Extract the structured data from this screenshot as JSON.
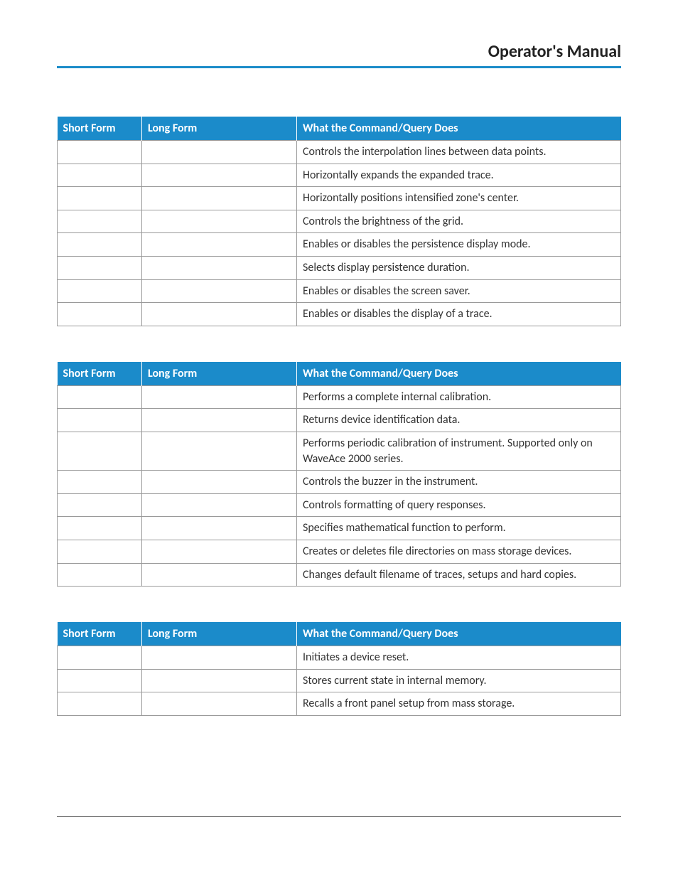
{
  "header": {
    "title": "Operator's Manual"
  },
  "tables": [
    {
      "title": "",
      "headers": [
        "Short Form",
        "Long Form",
        "What the Command/Query Does"
      ],
      "rows": [
        [
          "",
          "",
          "Controls the interpolation lines between data points."
        ],
        [
          "",
          "",
          "Horizontally expands the expanded trace."
        ],
        [
          "",
          "",
          "Horizontally positions intensified zone's center."
        ],
        [
          "",
          "",
          "Controls the brightness of the grid."
        ],
        [
          "",
          "",
          "Enables or disables the persistence display mode."
        ],
        [
          "",
          "",
          "Selects display persistence duration."
        ],
        [
          "",
          "",
          "Enables or disables the screen saver."
        ],
        [
          "",
          "",
          "Enables or disables the display of a trace."
        ]
      ]
    },
    {
      "title": "",
      "headers": [
        "Short Form",
        "Long Form",
        "What the Command/Query Does"
      ],
      "rows": [
        [
          "",
          "",
          "Performs a complete internal calibration."
        ],
        [
          "",
          "",
          "Returns device identification data."
        ],
        [
          "",
          "",
          "Performs periodic calibration of instrument. Supported only on WaveAce 2000 series."
        ],
        [
          "",
          "",
          "Controls the buzzer in the instrument."
        ],
        [
          "",
          "",
          "Controls formatting of query responses."
        ],
        [
          "",
          "",
          "Specifies mathematical function to perform."
        ],
        [
          "",
          "",
          "Creates or deletes file directories on mass storage devices."
        ],
        [
          "",
          "",
          "Changes default filename of traces, setups and hard copies."
        ]
      ]
    },
    {
      "title": "",
      "headers": [
        "Short Form",
        "Long Form",
        "What the Command/Query Does"
      ],
      "rows": [
        [
          "",
          "",
          "Initiates a device reset."
        ],
        [
          "",
          "",
          "Stores current state in internal memory."
        ],
        [
          "",
          "",
          "Recalls a front panel setup from mass storage."
        ]
      ]
    }
  ]
}
